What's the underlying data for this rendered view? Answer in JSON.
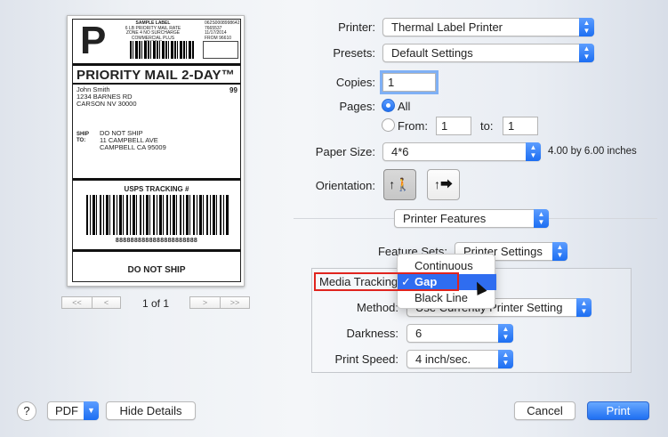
{
  "preview": {
    "big_letter": "P",
    "sample_label_lines": [
      "SAMPLE LABEL",
      "6 LB PRIORITY MAIL RATE",
      "ZONE 4 NO SURCHARGE",
      "COMMERCIAL PLUS PRICING"
    ],
    "right_lines": [
      "062S0008998642",
      "7665537",
      "11/17/2014",
      "FROM 96610"
    ],
    "service": "PRIORITY MAIL 2-DAY™",
    "from_lines": [
      "John Smith",
      "1234 BARNES RD",
      "CARSON NV 30000"
    ],
    "zone_code": "99",
    "ship_to_label": [
      "SHIP",
      "TO:"
    ],
    "ship_to_lines": [
      "DO NOT SHIP",
      "11 CAMPBELL AVE",
      "CAMPBELL CA 95009"
    ],
    "tracking_title": "USPS TRACKING #",
    "tracking_number": "8888888888888888888888",
    "footer": "DO NOT SHIP"
  },
  "pager": {
    "first": "<<",
    "prev": "<",
    "page_indicator": "1 of 1",
    "next": ">",
    "last": ">>"
  },
  "form": {
    "printer_label": "Printer:",
    "printer_value": "Thermal Label Printer",
    "presets_label": "Presets:",
    "presets_value": "Default Settings",
    "copies_label": "Copies:",
    "copies_value": "1",
    "pages_label": "Pages:",
    "pages_all": "All",
    "pages_from": "From:",
    "pages_from_value": "1",
    "pages_to": "to:",
    "pages_to_value": "1",
    "paper_size_label": "Paper Size:",
    "paper_size_value": "4*6",
    "paper_size_desc": "4.00 by 6.00 inches",
    "orientation_label": "Orientation:",
    "section_popup": "Printer Features"
  },
  "features": {
    "feature_sets_label": "Feature Sets:",
    "feature_sets_value": "Printer Settings",
    "media_tracking_label": "Media Tracking",
    "method_label": "Method:",
    "method_value": "Use Currently Printer Setting",
    "darkness_label": "Darkness:",
    "darkness_value": "6",
    "print_speed_label": "Print Speed:",
    "print_speed_value": "4 inch/sec."
  },
  "media_menu": {
    "items": [
      "Continuous",
      "Gap",
      "Black Line"
    ],
    "selected": "Gap",
    "check": "✓"
  },
  "buttons": {
    "help": "?",
    "pdf": "PDF",
    "hide_details": "Hide Details",
    "cancel": "Cancel",
    "print": "Print"
  },
  "colors": {
    "accent": "#2f6df0",
    "highlight": "#e0241e"
  }
}
